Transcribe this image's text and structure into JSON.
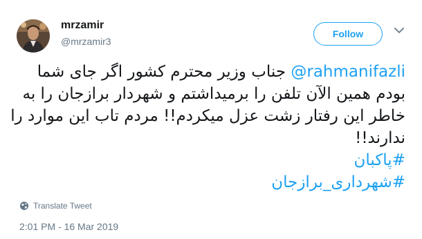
{
  "user": {
    "display_name": "mrzamir",
    "handle": "@mrzamir3"
  },
  "actions": {
    "follow_label": "Follow",
    "translate_label": "Translate Tweet"
  },
  "tweet": {
    "mention": "@rahmanifazli",
    "line1_text": " جناب وزیر محترم کشور اگر جای شما",
    "line2": "بودم همین الآن تلفن را برمیداشتم و شهردار برازجان را به",
    "line3": "خاطر این رفتار زشت عزل میکردم!! مردم تاب این موارد را",
    "line4": "ندارند!!",
    "hashtag1": "#پاکبان",
    "hashtag2": "#شهرداری_برازجان"
  },
  "timestamp": "2:01 PM - 16 Mar 2019",
  "colors": {
    "accent": "#1da1f2",
    "secondary_text": "#657786",
    "primary_text": "#14171a"
  }
}
